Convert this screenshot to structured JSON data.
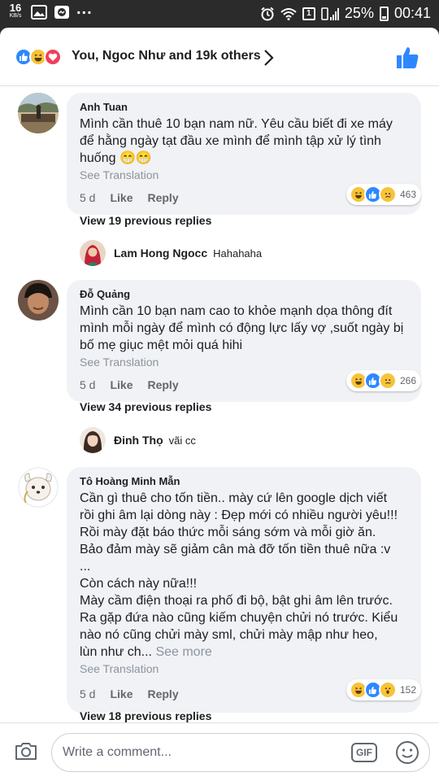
{
  "status_bar": {
    "speed_value": "16",
    "speed_unit": "KB/s",
    "more_dots": "...",
    "sim_badge": "1",
    "battery_pct": "25%",
    "time": "00:41",
    "icons": [
      "gallery-icon",
      "messenger-icon",
      "alarm-icon",
      "wifi-icon",
      "sim-icon",
      "signal-icon",
      "battery-icon"
    ]
  },
  "reactions": {
    "summary": "You, Ngoc Như and 19k others",
    "icons": [
      "like-icon",
      "haha-icon",
      "love-icon"
    ]
  },
  "comments": [
    {
      "name": "Anh Tuan",
      "text": "Mình cần thuê 10 bạn nam nữ. Yêu cầu biết đi xe máy để hằng ngày tạt đầu xe mình để mình tập xử lý tình huống 😁😁",
      "see_translation": "See Translation",
      "time": "5 d",
      "like": "Like",
      "reply": "Reply",
      "reaction_count": "463",
      "reaction_icons": [
        "haha-icon",
        "like-icon",
        "sad-icon"
      ],
      "view_replies": "View 19 previous replies",
      "last_reply": {
        "name": "Lam Hong Ngocc",
        "text": "Hahahaha"
      }
    },
    {
      "name": "Đỗ Quảng",
      "text": "Mình cần 10 bạn nam cao to khỏe mạnh dọa thông đít mình mỗi ngày để mình có động lực lấy vợ ,suốt ngày bị bố mẹ giục mệt mỏi quá hihi",
      "see_translation": "See Translation",
      "time": "5 d",
      "like": "Like",
      "reply": "Reply",
      "reaction_count": "266",
      "reaction_icons": [
        "haha-icon",
        "like-icon",
        "sad-icon"
      ],
      "view_replies": "View 34 previous replies",
      "last_reply": {
        "name": "Đinh Thọ",
        "text": "vãi cc"
      }
    },
    {
      "name": "Tô Hoàng Minh Mẫn",
      "lines": [
        "Cần gì thuê cho tốn tiền.. mày cứ lên google dịch viết",
        "rồi ghi âm lại dòng này : Đẹp mới có nhiều người yêu!!!",
        "Rồi mày đặt báo thức mỗi sáng sớm và mỗi giờ ăn.",
        "Bảo đảm mày sẽ giảm cân mà đỡ tốn tiền thuê nữa :v",
        "...",
        "Còn cách này nữa!!!",
        "Mày cầm điện thoại ra phố đi bộ, bật ghi âm lên trước.",
        "Ra gặp đứa nào cũng kiếm chuyện chửi nó trước. Kiểu",
        "nào nó cũng chửi mày sml, chửi mày mập như heo,"
      ],
      "last_line": "lùn như ch...",
      "see_more": "See more",
      "see_translation": "See Translation",
      "time": "5 d",
      "like": "Like",
      "reply": "Reply",
      "reaction_count": "152",
      "reaction_icons": [
        "haha-icon",
        "like-icon",
        "wow-icon"
      ],
      "view_replies": "View 18 previous replies"
    }
  ],
  "composer": {
    "placeholder": "Write a comment...",
    "gif_label": "GIF"
  },
  "colors": {
    "facebook_blue": "#2d88ff",
    "haha_yellow": "#f7c33a",
    "love_red": "#f33e58",
    "bubble_bg": "#f0f2f5",
    "muted_text": "#65676b"
  }
}
